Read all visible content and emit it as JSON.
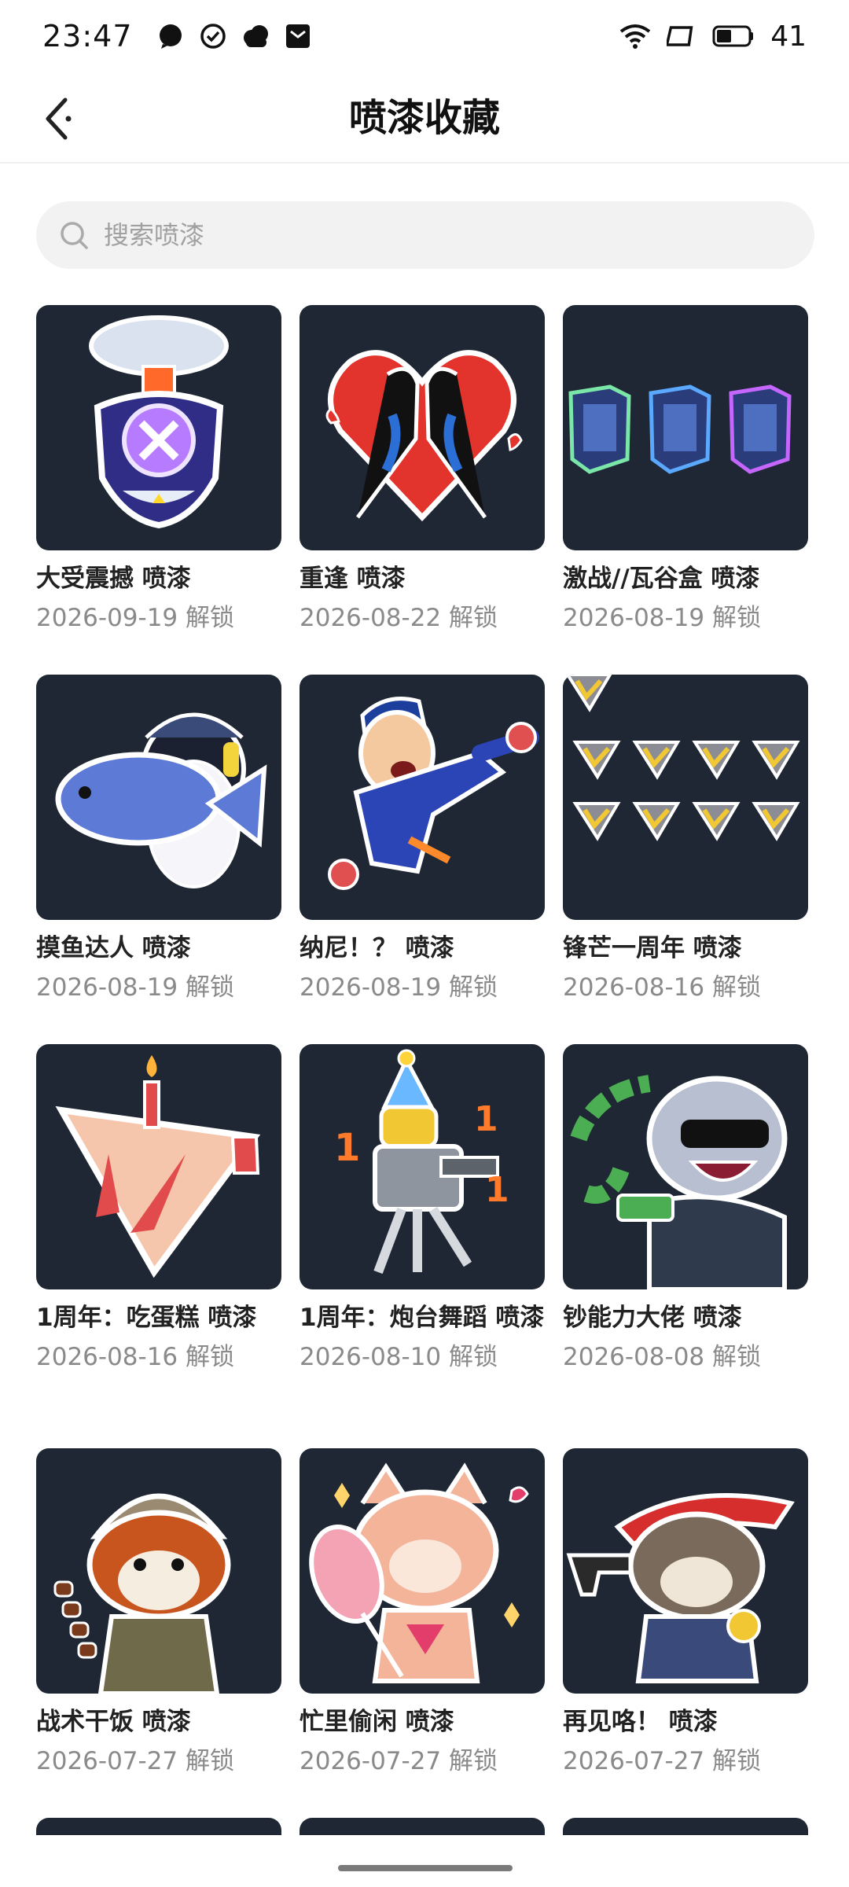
{
  "status_bar": {
    "time": "23:47",
    "battery": "41"
  },
  "header": {
    "title": "喷漆收藏"
  },
  "search": {
    "placeholder": "搜索喷漆"
  },
  "sprays": [
    {
      "title": "大受震撼 喷漆",
      "date": "2026-09-19 解锁",
      "art": "nuke-helmet"
    },
    {
      "title": "重逢 喷漆",
      "date": "2026-08-22 解锁",
      "art": "heart-magpies"
    },
    {
      "title": "激战//瓦谷盒 喷漆",
      "date": "2026-08-19 解锁",
      "art": "boxes"
    },
    {
      "title": "摸鱼达人 喷漆",
      "date": "2026-08-19 解锁",
      "art": "penguin-fish"
    },
    {
      "title": "纳尼！？ 喷漆",
      "date": "2026-08-19 解锁",
      "art": "shocked-agent"
    },
    {
      "title": "锋芒一周年 喷漆",
      "date": "2026-08-16 解锁",
      "art": "ranks"
    },
    {
      "title": "1周年：吃蛋糕 喷漆",
      "date": "2026-08-16 解锁",
      "art": "cake"
    },
    {
      "title": "1周年：炮台舞蹈 喷漆",
      "date": "2026-08-10 解锁",
      "art": "turret"
    },
    {
      "title": "钞能力大佬 喷漆",
      "date": "2026-08-08 解锁",
      "art": "rich-sloth"
    },
    {
      "title": "战术干饭 喷漆",
      "date": "2026-07-27 解锁",
      "art": "red-panda"
    },
    {
      "title": "忙里偷闲 喷漆",
      "date": "2026-07-27 解锁",
      "art": "cat-fan"
    },
    {
      "title": "再见咯！ 喷漆",
      "date": "2026-07-27 解锁",
      "art": "raccoon-gun"
    }
  ]
}
